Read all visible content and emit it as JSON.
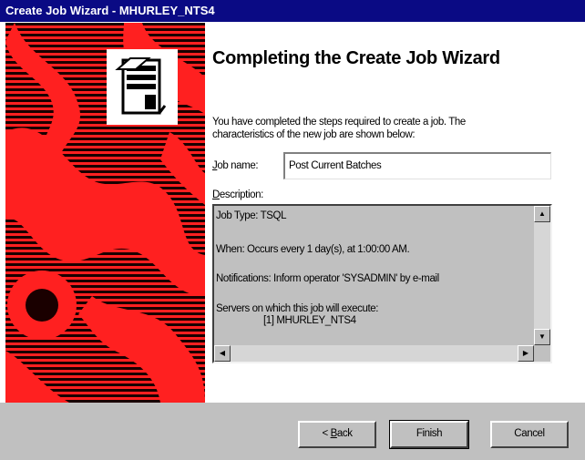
{
  "window": {
    "title": "Create Job Wizard - MHURLEY_NTS4"
  },
  "banner": {
    "icon": "server-icon"
  },
  "heading": "Completing the Create Job Wizard",
  "intro": {
    "line1": "You have completed the steps required to create a job. The",
    "line2": "characteristics of the new job are shown below:"
  },
  "job_name": {
    "label_mnemonic": "J",
    "label_rest": "ob name:",
    "value": "Post Current Batches"
  },
  "description": {
    "label_mnemonic": "D",
    "label_rest": "escription:",
    "lines": [
      "Job Type: TSQL",
      "When: Occurs every 1 day(s), at 1:00:00 AM.",
      "Notifications: Inform operator 'SYSADMIN' by e-mail",
      "Servers on which this job will execute:",
      "[1] MHURLEY_NTS4"
    ]
  },
  "buttons": {
    "back": {
      "prefix": "< ",
      "mnemonic": "B",
      "rest": "ack"
    },
    "finish": "Finish",
    "cancel": "Cancel"
  },
  "colors": {
    "title_bar": "#0a0a84",
    "banner": "#ff2020",
    "dialog_face": "#c0c0c0"
  }
}
